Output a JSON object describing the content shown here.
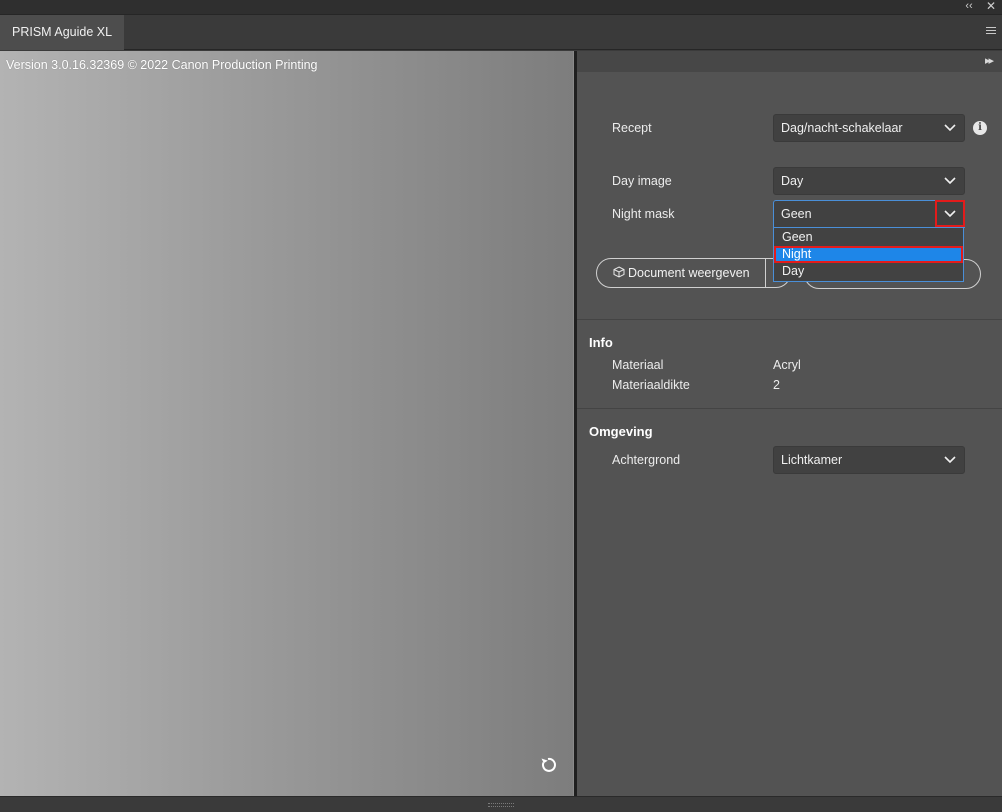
{
  "window": {
    "collapse_glyph": "‹‹",
    "close_glyph": "✕"
  },
  "tab": {
    "label": "PRISM Aguide XL"
  },
  "preview": {
    "version_text": "Version 3.0.16.32369 © 2022 Canon Production Printing"
  },
  "panel": {
    "expand_glyph": "▸▸",
    "recept": {
      "label": "Recept",
      "value": "Dag/nacht-schakelaar"
    },
    "day_image": {
      "label": "Day image",
      "value": "Day"
    },
    "night_mask": {
      "label": "Night mask",
      "value": "Geen",
      "options": [
        "Geen",
        "Night",
        "Day"
      ],
      "highlighted_option": "Night"
    },
    "document_button": {
      "label": "Document weergeven"
    },
    "info": {
      "title": "Info",
      "rows": [
        {
          "label": "Materiaal",
          "value": "Acryl"
        },
        {
          "label": "Materiaaldikte",
          "value": "2"
        }
      ]
    },
    "omgeving": {
      "title": "Omgeving",
      "achtergrond": {
        "label": "Achtergrond",
        "value": "Lichtkamer"
      }
    }
  },
  "icons": {
    "info": "info-icon",
    "chevron": "chevron-down-icon",
    "refresh": "refresh-icon",
    "cube": "cube-icon",
    "menu": "hamburger-menu-icon"
  }
}
